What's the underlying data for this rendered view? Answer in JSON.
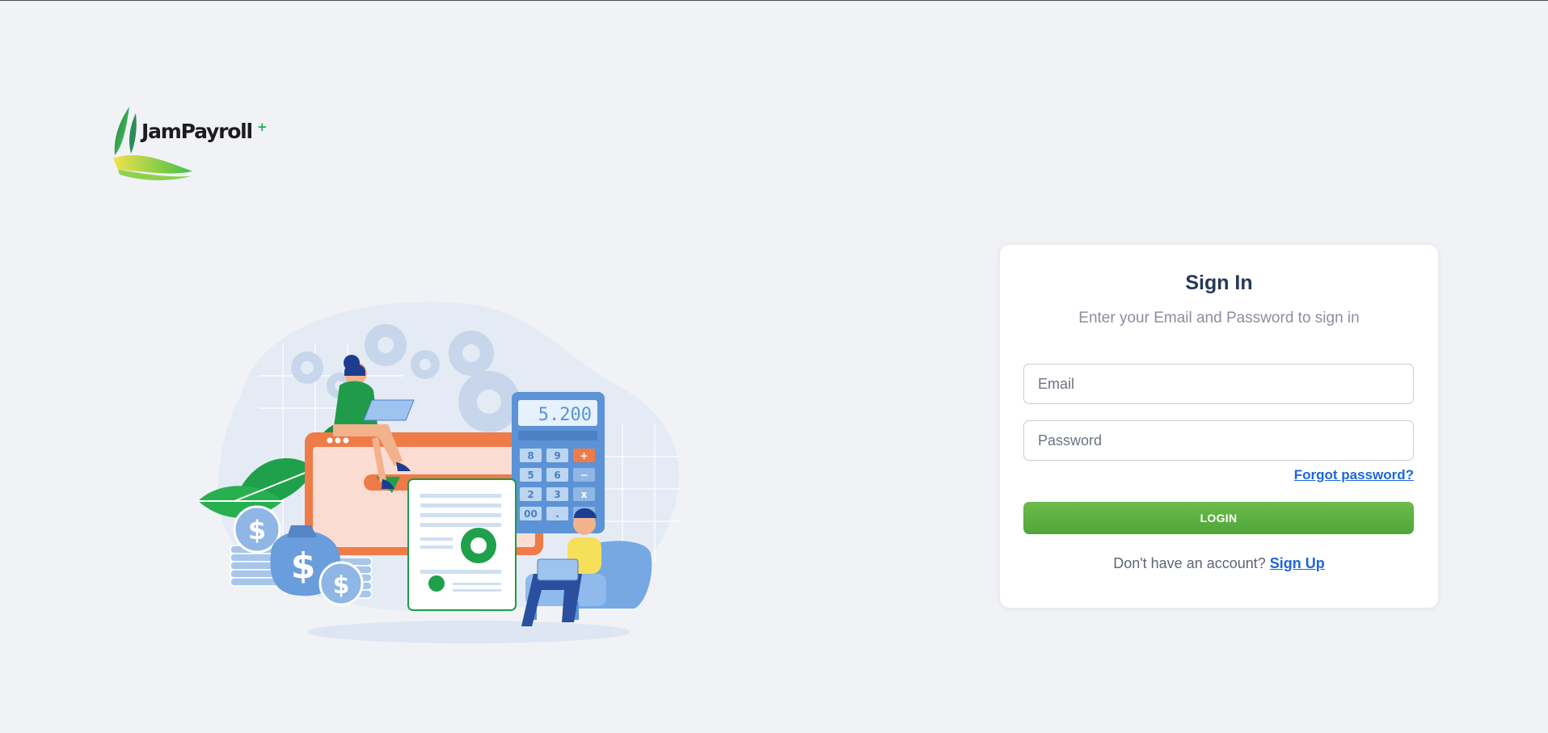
{
  "brand": {
    "logo_text": "JamPayroll",
    "logo_superscript": "+"
  },
  "illustration": {
    "calculator_display": "5.200",
    "calculator_keys": [
      "8",
      "9",
      "+",
      "5",
      "6",
      "−",
      "2",
      "3",
      "x",
      "00",
      ".",
      "="
    ]
  },
  "signin": {
    "title": "Sign In",
    "subtitle": "Enter your Email and Password to sign in",
    "email_placeholder": "Email",
    "email_value": "",
    "password_placeholder": "Password",
    "password_value": "",
    "forgot_label": "Forgot password?",
    "login_label": "LOGIN",
    "no_account_text": "Don't have an account?",
    "signup_label": "Sign Up"
  },
  "colors": {
    "background": "#f1f2f6",
    "primary_green": "#5cb443",
    "link_blue": "#1c66dc",
    "title_navy": "#263a56"
  }
}
